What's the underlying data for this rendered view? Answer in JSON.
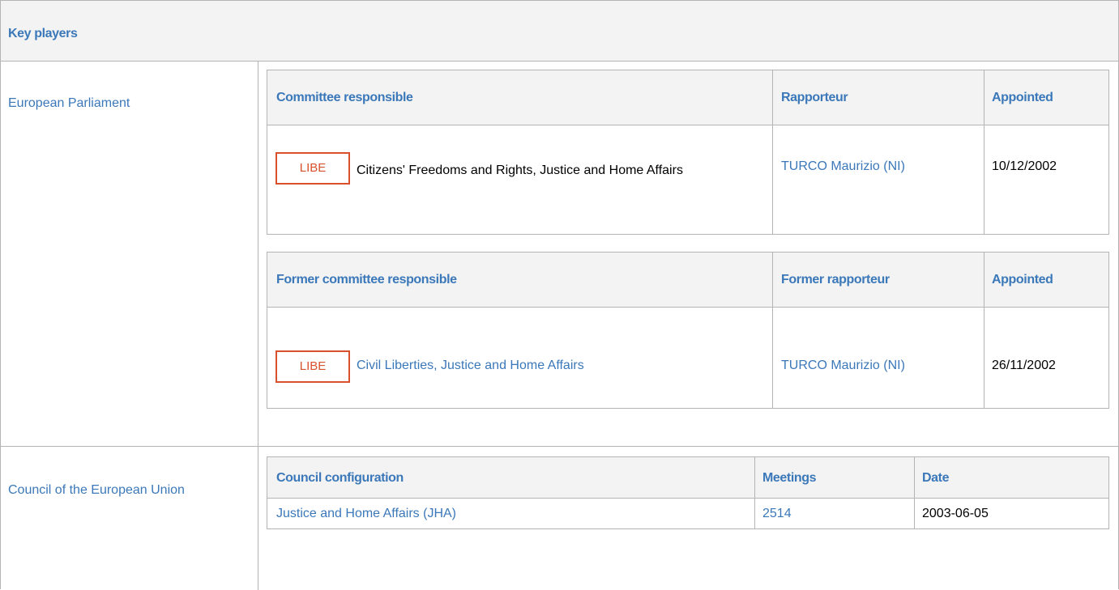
{
  "header": {
    "title": "Key players"
  },
  "european_parliament": {
    "label": "European Parliament",
    "committee_table": {
      "col_committee": "Committee responsible",
      "col_rapporteur": "Rapporteur",
      "col_appointed": "Appointed",
      "row": {
        "badge": "LIBE",
        "committee_name": "Citizens' Freedoms and Rights, Justice and Home Affairs",
        "rapporteur": "TURCO Maurizio (NI)",
        "appointed": "10/12/2002"
      }
    },
    "former_table": {
      "col_committee": "Former committee responsible",
      "col_rapporteur": "Former rapporteur",
      "col_appointed": "Appointed",
      "row": {
        "badge": "LIBE",
        "committee_name": "Civil Liberties, Justice and Home Affairs",
        "rapporteur": "TURCO Maurizio (NI)",
        "appointed": "26/11/2002"
      }
    }
  },
  "council": {
    "label": "Council of the European Union",
    "table": {
      "col_configuration": "Council configuration",
      "col_meetings": "Meetings",
      "col_date": "Date",
      "row": {
        "configuration": "Justice and Home Affairs (JHA)",
        "meetings": "2514",
        "date": "2003-06-05"
      }
    }
  },
  "colors": {
    "link_blue": "#3b78b9",
    "badge_red": "#d9512c",
    "header_gray": "#f3f3f3",
    "border_gray": "#b4b4b4"
  }
}
